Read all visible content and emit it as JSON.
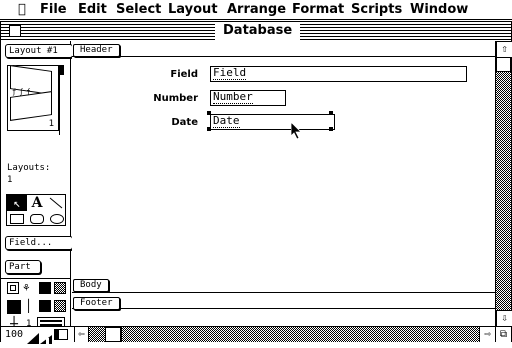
{
  "menubar": {
    "apple_icon": "apple-icon",
    "items": [
      "File",
      "Edit",
      "Select",
      "Layout",
      "Arrange",
      "Format",
      "Scripts",
      "Window"
    ]
  },
  "window": {
    "title": "Database"
  },
  "palette": {
    "layout_popup": "Layout #1",
    "book_page": "1",
    "layouts_label": "Layouts:",
    "layouts_count": "1",
    "tools": [
      "arrow-tool-icon",
      "text-tool-icon",
      "line-tool-icon",
      "rectangle-tool-icon",
      "rounded-rectangle-tool-icon",
      "oval-tool-icon"
    ],
    "field_button": "Field...",
    "part_button": "Part",
    "line_width_value": "1",
    "zoom_level": "100"
  },
  "layout": {
    "header_part": "Header",
    "body_part": "Body",
    "footer_part": "Footer",
    "fields": [
      {
        "label": "Field",
        "value": "Field"
      },
      {
        "label": "Number",
        "value": "Number"
      },
      {
        "label": "Date",
        "value": "Date"
      }
    ]
  }
}
